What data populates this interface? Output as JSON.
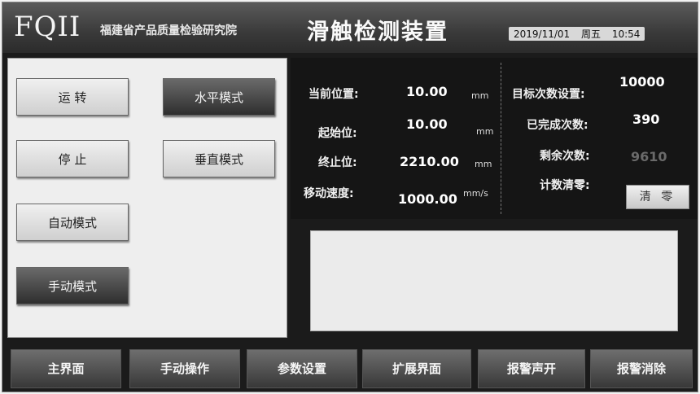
{
  "header": {
    "logo": "FQII",
    "org": "福建省产品质量检验研究院",
    "title": "滑触检测装置",
    "date": "2019/11/01",
    "weekday": "周五",
    "time": "10:54"
  },
  "left": {
    "run": "运 转",
    "stop": "停 止",
    "auto_mode": "自动模式",
    "manual_mode": "手动模式",
    "horizontal_mode": "水平模式",
    "vertical_mode": "垂直模式"
  },
  "info": {
    "current_position": {
      "label": "当前位置:",
      "value": "10.00",
      "unit": "mm"
    },
    "start_position": {
      "label": "起始位:",
      "value": "10.00",
      "unit": "mm"
    },
    "end_position": {
      "label": "终止位:",
      "value": "2210.00",
      "unit": "mm"
    },
    "speed": {
      "label": "移动速度:",
      "value": "1000.00",
      "unit": "mm/s"
    },
    "target_count": {
      "label": "目标次数设置:",
      "value": "10000"
    },
    "completed_count": {
      "label": "已完成次数:",
      "value": "390"
    },
    "remaining_count": {
      "label": "剩余次数:",
      "value": "9610"
    },
    "count_clear": {
      "label": "计数清零:",
      "button": "清 零"
    }
  },
  "nav": {
    "main": "主界面",
    "manual_op": "手动操作",
    "params": "参数设置",
    "extend": "扩展界面",
    "alarm_sound": "报警声开",
    "alarm_clear": "报警消除"
  }
}
